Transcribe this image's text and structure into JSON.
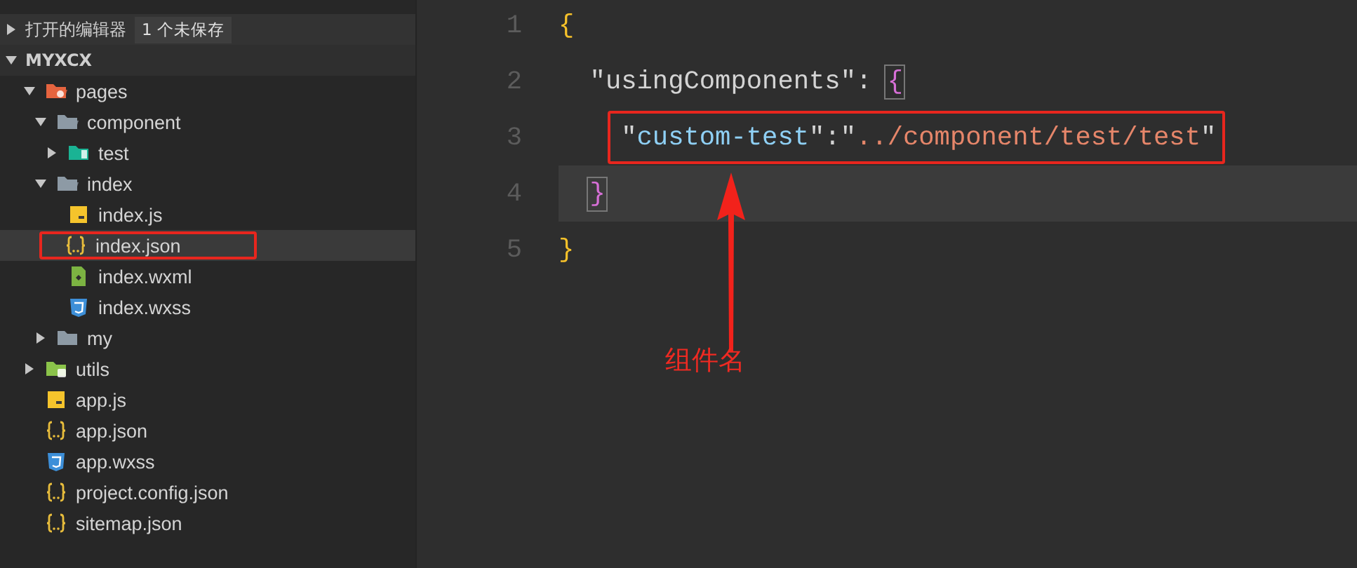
{
  "explorer": {
    "open_editors": {
      "label": "打开的编辑器",
      "badge": "1 个未保存",
      "expanded": false
    },
    "project": {
      "name": "MYXCX",
      "expanded": true
    },
    "tree": [
      {
        "kind": "pages",
        "label": "pages",
        "expanded": true,
        "selected": false,
        "boxed": false,
        "children": [
          {
            "kind": "folder",
            "label": "component",
            "expanded": true,
            "selected": false,
            "boxed": false,
            "children": [
              {
                "kind": "component",
                "label": "test",
                "expanded": false,
                "selected": false,
                "boxed": false
              }
            ]
          },
          {
            "kind": "folder",
            "label": "index",
            "expanded": true,
            "selected": false,
            "boxed": false,
            "children": [
              {
                "kind": "js",
                "label": "index.js",
                "selected": false,
                "boxed": false
              },
              {
                "kind": "json",
                "label": "index.json",
                "selected": true,
                "boxed": true
              },
              {
                "kind": "wxml",
                "label": "index.wxml",
                "selected": false,
                "boxed": false
              },
              {
                "kind": "wxss",
                "label": "index.wxss",
                "selected": false,
                "boxed": false
              }
            ]
          },
          {
            "kind": "folder",
            "label": "my",
            "expanded": false,
            "selected": false,
            "boxed": false
          }
        ]
      },
      {
        "kind": "utils",
        "label": "utils",
        "expanded": false,
        "selected": false,
        "boxed": false
      },
      {
        "kind": "js",
        "label": "app.js",
        "selected": false,
        "boxed": false
      },
      {
        "kind": "json",
        "label": "app.json",
        "selected": false,
        "boxed": false
      },
      {
        "kind": "wxss",
        "label": "app.wxss",
        "selected": false,
        "boxed": false
      },
      {
        "kind": "json",
        "label": "project.config.json",
        "selected": false,
        "boxed": false
      },
      {
        "kind": "json",
        "label": "sitemap.json",
        "selected": false,
        "boxed": false
      }
    ]
  },
  "editor": {
    "lines": [
      {
        "number": "1",
        "current": false,
        "boxed": false,
        "tokens": [
          {
            "kind": "open-outer",
            "text": "{"
          }
        ]
      },
      {
        "number": "2",
        "current": false,
        "boxed": false,
        "tokens": [
          {
            "kind": "key",
            "text": "\"usingComponents\""
          },
          {
            "kind": "punct",
            "text": ": "
          },
          {
            "kind": "open-inner",
            "text": "{"
          }
        ]
      },
      {
        "number": "3",
        "current": false,
        "boxed": true,
        "tokens": [
          {
            "kind": "punct",
            "text": "\""
          },
          {
            "kind": "prop",
            "text": "custom-test"
          },
          {
            "kind": "punct",
            "text": "\":\""
          },
          {
            "kind": "string",
            "text": "../component/test/test"
          },
          {
            "kind": "punct",
            "text": "\""
          }
        ]
      },
      {
        "number": "4",
        "current": true,
        "boxed": false,
        "tokens": [
          {
            "kind": "close-inner",
            "text": "}"
          }
        ]
      },
      {
        "number": "5",
        "current": false,
        "boxed": false,
        "tokens": [
          {
            "kind": "close-outer",
            "text": "}"
          }
        ]
      }
    ]
  },
  "annotation": {
    "label": "组件名"
  }
}
